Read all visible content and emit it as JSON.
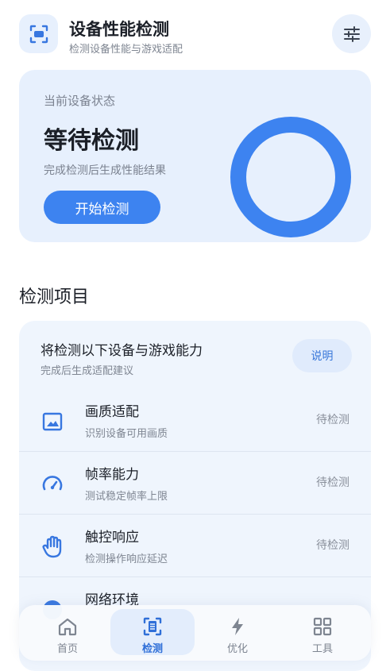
{
  "header": {
    "title": "设备性能检测",
    "subtitle": "检测设备性能与游戏适配"
  },
  "status_card": {
    "label": "当前设备状态",
    "value": "等待检测",
    "description": "完成检测后生成性能结果",
    "start_button": "开始检测",
    "ring_color": "#3d83f0"
  },
  "section": {
    "title": "检测项目"
  },
  "list": {
    "head_title": "将检测以下设备与游戏能力",
    "head_subtitle": "完成后生成适配建议",
    "explain_button": "说明",
    "items": [
      {
        "name": "画质适配",
        "desc": "识别设备可用画质",
        "status": "待检测",
        "icon": "image-icon"
      },
      {
        "name": "帧率能力",
        "desc": "测试稳定帧率上限",
        "status": "待检测",
        "icon": "speedometer-icon"
      },
      {
        "name": "触控响应",
        "desc": "检测操作响应延迟",
        "status": "待检测",
        "icon": "hand-icon"
      },
      {
        "name": "网络环境",
        "desc": "",
        "status": "",
        "icon": "network-icon"
      }
    ]
  },
  "nav": {
    "items": [
      {
        "label": "首页",
        "icon": "home-icon"
      },
      {
        "label": "检测",
        "icon": "scan-icon",
        "active": true
      },
      {
        "label": "优化",
        "icon": "bolt-icon"
      },
      {
        "label": "工具",
        "icon": "grid-icon"
      }
    ]
  },
  "colors": {
    "accent": "#3d83f0",
    "card_bg": "#e7f0fd"
  }
}
